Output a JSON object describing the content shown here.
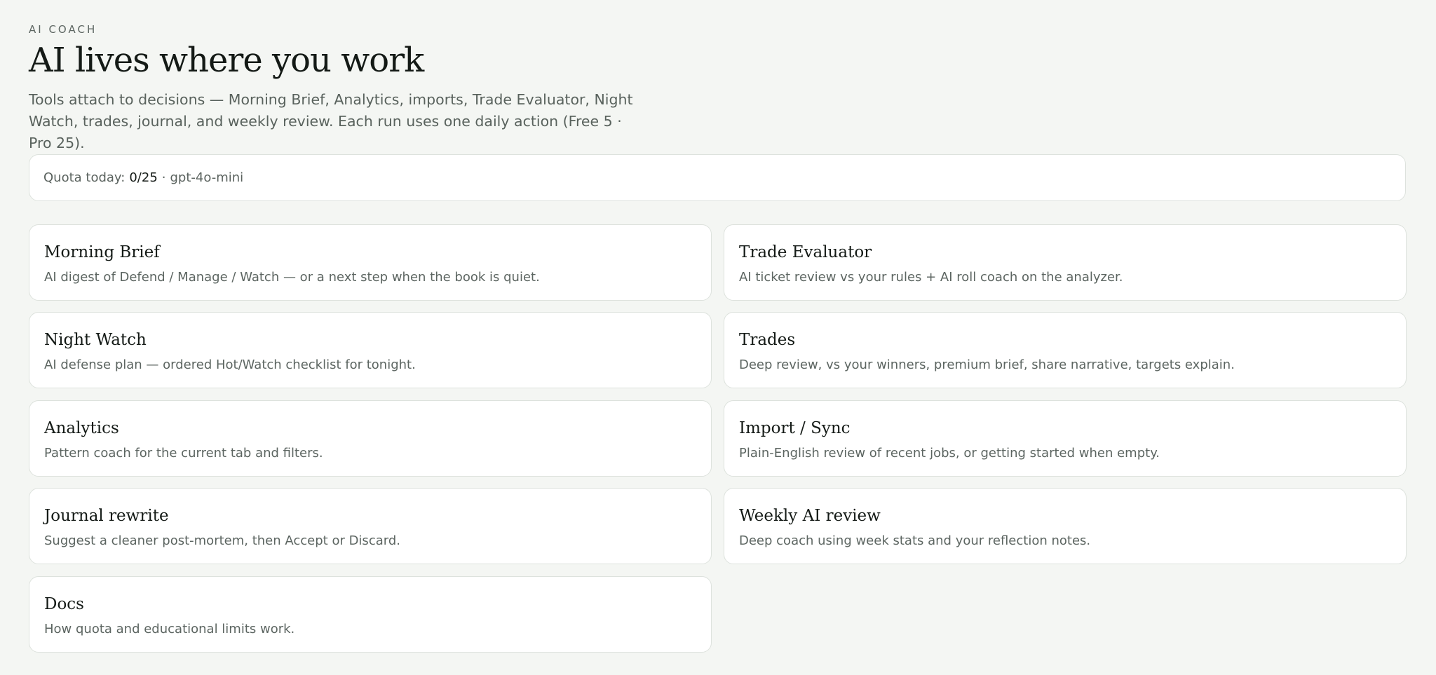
{
  "header": {
    "eyebrow": "AI COACH",
    "title": "AI lives where you work",
    "subtitle": "Tools attach to decisions — Morning Brief, Analytics, imports, Trade Evaluator, Night Watch, trades, journal, and weekly review. Each run uses one daily action (Free 5 · Pro 25)."
  },
  "quota": {
    "label": "Quota today:",
    "value": "0/25",
    "separator": "·",
    "model": "gpt-4o-mini"
  },
  "tools": [
    {
      "title": "Morning Brief",
      "description": "AI digest of Defend / Manage / Watch — or a next step when the book is quiet."
    },
    {
      "title": "Trade Evaluator",
      "description": "AI ticket review vs your rules + AI roll coach on the analyzer."
    },
    {
      "title": "Night Watch",
      "description": "AI defense plan — ordered Hot/Watch checklist for tonight."
    },
    {
      "title": "Trades",
      "description": "Deep review, vs your winners, premium brief, share narrative, targets explain."
    },
    {
      "title": "Analytics",
      "description": "Pattern coach for the current tab and filters."
    },
    {
      "title": "Import / Sync",
      "description": "Plain-English review of recent jobs, or getting started when empty."
    },
    {
      "title": "Journal rewrite",
      "description": "Suggest a cleaner post-mortem, then Accept or Discard."
    },
    {
      "title": "Weekly AI review",
      "description": "Deep coach using week stats and your reflection notes."
    },
    {
      "title": "Docs",
      "description": "How quota and educational limits work."
    }
  ]
}
